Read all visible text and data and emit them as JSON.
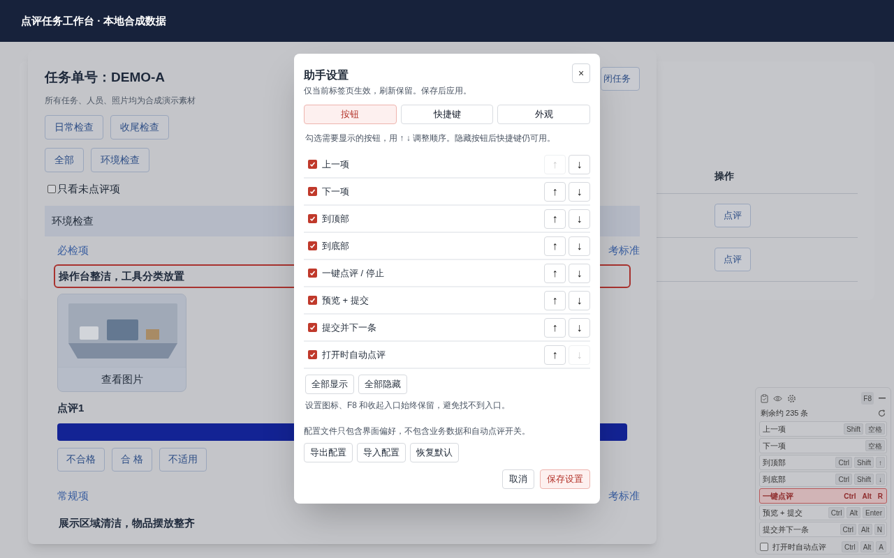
{
  "header": {
    "title": "点评任务工作台 · 本地合成数据"
  },
  "background_table": {
    "column_header": "操作",
    "rows": [
      {
        "action": "点评"
      },
      {
        "action": "点评"
      }
    ]
  },
  "task": {
    "title": "任务单号：DEMO-A",
    "subtitle": "所有任务、人员、照片均为合成演示素材",
    "close_button": "闭任务",
    "check_types": [
      {
        "label": "日常检查"
      },
      {
        "label": "收尾检查"
      }
    ],
    "categories": [
      {
        "label": "全部"
      },
      {
        "label": "环境检查"
      }
    ],
    "only_unreviewed": {
      "label": "只看未点评项",
      "checked": false
    },
    "section": "环境检查",
    "groups": [
      {
        "title": "必检项",
        "link": "考标准",
        "items": [
          {
            "title": "操作台整洁，工具分类放置",
            "highlighted": true,
            "photo_button": "查看图片",
            "review_label": "点评1",
            "verdicts": [
              "不合格",
              "合 格",
              "不适用"
            ]
          }
        ]
      },
      {
        "title": "常规项",
        "link": "考标准",
        "items": [
          {
            "title": "展示区域清洁，物品摆放整齐",
            "highlighted": false
          }
        ]
      }
    ]
  },
  "dialog": {
    "title": "助手设置",
    "close": "×",
    "note": "仅当前标签页生效，刷新保留。保存后应用。",
    "tabs": [
      {
        "label": "按钮",
        "selected": true
      },
      {
        "label": "快捷键",
        "selected": false
      },
      {
        "label": "外观",
        "selected": false
      }
    ],
    "hint": "勾选需要显示的按钮，用 ↑ ↓ 调整顺序。隐藏按钮后快捷键仍可用。",
    "items": [
      {
        "label": "上一项",
        "checked": true,
        "up": "↑",
        "down": "↓",
        "up_disabled": true,
        "down_disabled": false
      },
      {
        "label": "下一项",
        "checked": true,
        "up": "↑",
        "down": "↓",
        "up_disabled": false,
        "down_disabled": false
      },
      {
        "label": "到顶部",
        "checked": true,
        "up": "↑",
        "down": "↓",
        "up_disabled": false,
        "down_disabled": false
      },
      {
        "label": "到底部",
        "checked": true,
        "up": "↑",
        "down": "↓",
        "up_disabled": false,
        "down_disabled": false
      },
      {
        "label": "一键点评 / 停止",
        "checked": true,
        "up": "↑",
        "down": "↓",
        "up_disabled": false,
        "down_disabled": false
      },
      {
        "label": "预览 + 提交",
        "checked": true,
        "up": "↑",
        "down": "↓",
        "up_disabled": false,
        "down_disabled": false
      },
      {
        "label": "提交并下一条",
        "checked": true,
        "up": "↑",
        "down": "↓",
        "up_disabled": false,
        "down_disabled": false
      },
      {
        "label": "打开时自动点评",
        "checked": true,
        "up": "↑",
        "down": "↓",
        "up_disabled": false,
        "down_disabled": true
      }
    ],
    "bulk_buttons": [
      "全部显示",
      "全部隐藏"
    ],
    "bulk_note": "设置图标、F8 和收起入口始终保留，避免找不到入口。",
    "config_note": "配置文件只包含界面偏好，不包含业务数据和自动点评开关。",
    "config_buttons": [
      "导出配置",
      "导入配置",
      "恢复默认"
    ],
    "cancel": "取消",
    "save": "保存设置"
  },
  "helper": {
    "f8": "F8",
    "remaining": "剩余约 235 条",
    "actions": [
      {
        "kind": "button",
        "label": "上一项",
        "keys": [
          "Shift",
          "空格"
        ],
        "active": false
      },
      {
        "kind": "button",
        "label": "下一项",
        "keys": [
          "空格"
        ],
        "active": false
      },
      {
        "kind": "button",
        "label": "到顶部",
        "keys": [
          "Ctrl",
          "Shift",
          "↑"
        ],
        "active": false
      },
      {
        "kind": "button",
        "label": "到底部",
        "keys": [
          "Ctrl",
          "Shift",
          "↓"
        ],
        "active": false
      },
      {
        "kind": "button",
        "label": "一键点评",
        "keys": [
          "Ctrl",
          "Alt",
          "R"
        ],
        "active": true
      },
      {
        "kind": "button",
        "label": "预览 + 提交",
        "keys": [
          "Ctrl",
          "Alt",
          "Enter"
        ],
        "active": false
      },
      {
        "kind": "button",
        "label": "提交并下一条",
        "keys": [
          "Ctrl",
          "Alt",
          "N"
        ],
        "active": false
      },
      {
        "kind": "toggle",
        "label": "打开时自动点评",
        "keys": [
          "Ctrl",
          "Alt",
          "A"
        ],
        "checked": false
      }
    ]
  }
}
